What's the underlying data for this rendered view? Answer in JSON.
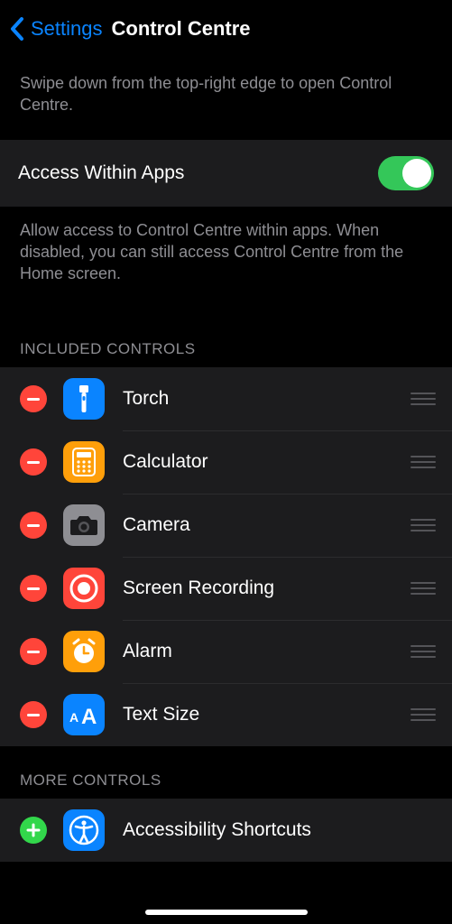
{
  "nav": {
    "back_label": "Settings",
    "title": "Control Centre"
  },
  "intro_text": "Swipe down from the top-right edge to open Control Centre.",
  "access_row": {
    "title": "Access Within Apps",
    "on": true
  },
  "access_footer": "Allow access to Control Centre within apps. When disabled, you can still access Control Centre from the Home screen.",
  "included_header": "Included Controls",
  "included": [
    {
      "label": "Torch"
    },
    {
      "label": "Calculator"
    },
    {
      "label": "Camera"
    },
    {
      "label": "Screen Recording"
    },
    {
      "label": "Alarm"
    },
    {
      "label": "Text Size"
    }
  ],
  "more_header": "More Controls",
  "more": [
    {
      "label": "Accessibility Shortcuts"
    }
  ]
}
